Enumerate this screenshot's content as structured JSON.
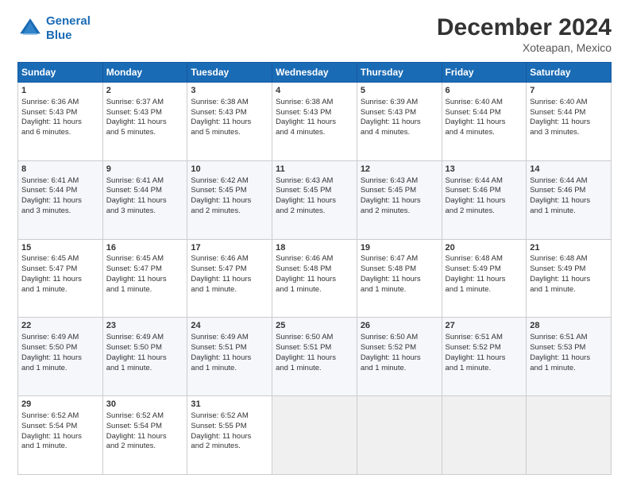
{
  "header": {
    "logo_line1": "General",
    "logo_line2": "Blue",
    "month_title": "December 2024",
    "location": "Xoteapan, Mexico"
  },
  "days_of_week": [
    "Sunday",
    "Monday",
    "Tuesday",
    "Wednesday",
    "Thursday",
    "Friday",
    "Saturday"
  ],
  "weeks": [
    [
      {
        "day": "1",
        "lines": [
          "Sunrise: 6:36 AM",
          "Sunset: 5:43 PM",
          "Daylight: 11 hours",
          "and 6 minutes."
        ]
      },
      {
        "day": "2",
        "lines": [
          "Sunrise: 6:37 AM",
          "Sunset: 5:43 PM",
          "Daylight: 11 hours",
          "and 5 minutes."
        ]
      },
      {
        "day": "3",
        "lines": [
          "Sunrise: 6:38 AM",
          "Sunset: 5:43 PM",
          "Daylight: 11 hours",
          "and 5 minutes."
        ]
      },
      {
        "day": "4",
        "lines": [
          "Sunrise: 6:38 AM",
          "Sunset: 5:43 PM",
          "Daylight: 11 hours",
          "and 4 minutes."
        ]
      },
      {
        "day": "5",
        "lines": [
          "Sunrise: 6:39 AM",
          "Sunset: 5:43 PM",
          "Daylight: 11 hours",
          "and 4 minutes."
        ]
      },
      {
        "day": "6",
        "lines": [
          "Sunrise: 6:40 AM",
          "Sunset: 5:44 PM",
          "Daylight: 11 hours",
          "and 4 minutes."
        ]
      },
      {
        "day": "7",
        "lines": [
          "Sunrise: 6:40 AM",
          "Sunset: 5:44 PM",
          "Daylight: 11 hours",
          "and 3 minutes."
        ]
      }
    ],
    [
      {
        "day": "8",
        "lines": [
          "Sunrise: 6:41 AM",
          "Sunset: 5:44 PM",
          "Daylight: 11 hours",
          "and 3 minutes."
        ]
      },
      {
        "day": "9",
        "lines": [
          "Sunrise: 6:41 AM",
          "Sunset: 5:44 PM",
          "Daylight: 11 hours",
          "and 3 minutes."
        ]
      },
      {
        "day": "10",
        "lines": [
          "Sunrise: 6:42 AM",
          "Sunset: 5:45 PM",
          "Daylight: 11 hours",
          "and 2 minutes."
        ]
      },
      {
        "day": "11",
        "lines": [
          "Sunrise: 6:43 AM",
          "Sunset: 5:45 PM",
          "Daylight: 11 hours",
          "and 2 minutes."
        ]
      },
      {
        "day": "12",
        "lines": [
          "Sunrise: 6:43 AM",
          "Sunset: 5:45 PM",
          "Daylight: 11 hours",
          "and 2 minutes."
        ]
      },
      {
        "day": "13",
        "lines": [
          "Sunrise: 6:44 AM",
          "Sunset: 5:46 PM",
          "Daylight: 11 hours",
          "and 2 minutes."
        ]
      },
      {
        "day": "14",
        "lines": [
          "Sunrise: 6:44 AM",
          "Sunset: 5:46 PM",
          "Daylight: 11 hours",
          "and 1 minute."
        ]
      }
    ],
    [
      {
        "day": "15",
        "lines": [
          "Sunrise: 6:45 AM",
          "Sunset: 5:47 PM",
          "Daylight: 11 hours",
          "and 1 minute."
        ]
      },
      {
        "day": "16",
        "lines": [
          "Sunrise: 6:45 AM",
          "Sunset: 5:47 PM",
          "Daylight: 11 hours",
          "and 1 minute."
        ]
      },
      {
        "day": "17",
        "lines": [
          "Sunrise: 6:46 AM",
          "Sunset: 5:47 PM",
          "Daylight: 11 hours",
          "and 1 minute."
        ]
      },
      {
        "day": "18",
        "lines": [
          "Sunrise: 6:46 AM",
          "Sunset: 5:48 PM",
          "Daylight: 11 hours",
          "and 1 minute."
        ]
      },
      {
        "day": "19",
        "lines": [
          "Sunrise: 6:47 AM",
          "Sunset: 5:48 PM",
          "Daylight: 11 hours",
          "and 1 minute."
        ]
      },
      {
        "day": "20",
        "lines": [
          "Sunrise: 6:48 AM",
          "Sunset: 5:49 PM",
          "Daylight: 11 hours",
          "and 1 minute."
        ]
      },
      {
        "day": "21",
        "lines": [
          "Sunrise: 6:48 AM",
          "Sunset: 5:49 PM",
          "Daylight: 11 hours",
          "and 1 minute."
        ]
      }
    ],
    [
      {
        "day": "22",
        "lines": [
          "Sunrise: 6:49 AM",
          "Sunset: 5:50 PM",
          "Daylight: 11 hours",
          "and 1 minute."
        ]
      },
      {
        "day": "23",
        "lines": [
          "Sunrise: 6:49 AM",
          "Sunset: 5:50 PM",
          "Daylight: 11 hours",
          "and 1 minute."
        ]
      },
      {
        "day": "24",
        "lines": [
          "Sunrise: 6:49 AM",
          "Sunset: 5:51 PM",
          "Daylight: 11 hours",
          "and 1 minute."
        ]
      },
      {
        "day": "25",
        "lines": [
          "Sunrise: 6:50 AM",
          "Sunset: 5:51 PM",
          "Daylight: 11 hours",
          "and 1 minute."
        ]
      },
      {
        "day": "26",
        "lines": [
          "Sunrise: 6:50 AM",
          "Sunset: 5:52 PM",
          "Daylight: 11 hours",
          "and 1 minute."
        ]
      },
      {
        "day": "27",
        "lines": [
          "Sunrise: 6:51 AM",
          "Sunset: 5:52 PM",
          "Daylight: 11 hours",
          "and 1 minute."
        ]
      },
      {
        "day": "28",
        "lines": [
          "Sunrise: 6:51 AM",
          "Sunset: 5:53 PM",
          "Daylight: 11 hours",
          "and 1 minute."
        ]
      }
    ],
    [
      {
        "day": "29",
        "lines": [
          "Sunrise: 6:52 AM",
          "Sunset: 5:54 PM",
          "Daylight: 11 hours",
          "and 1 minute."
        ]
      },
      {
        "day": "30",
        "lines": [
          "Sunrise: 6:52 AM",
          "Sunset: 5:54 PM",
          "Daylight: 11 hours",
          "and 2 minutes."
        ]
      },
      {
        "day": "31",
        "lines": [
          "Sunrise: 6:52 AM",
          "Sunset: 5:55 PM",
          "Daylight: 11 hours",
          "and 2 minutes."
        ]
      },
      null,
      null,
      null,
      null
    ]
  ]
}
